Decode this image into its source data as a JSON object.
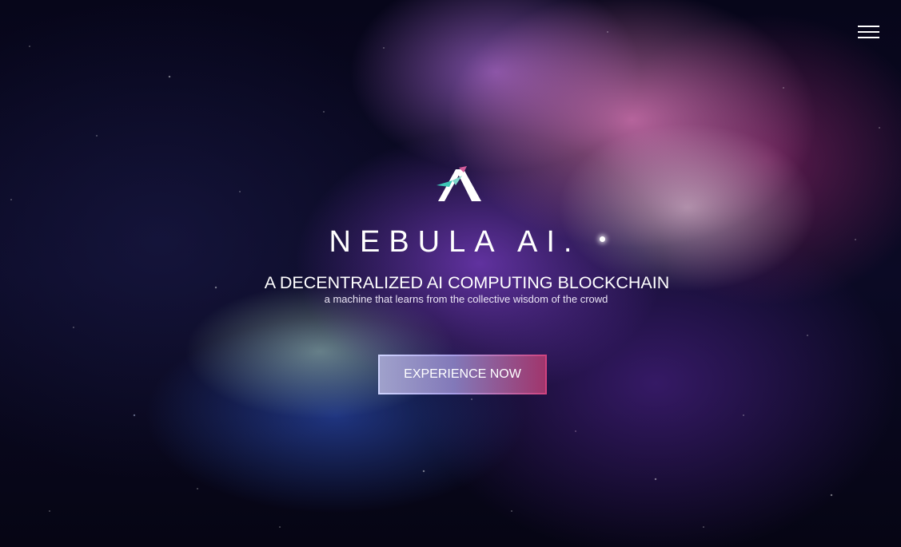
{
  "header": {
    "menu_icon": "hamburger-menu-icon"
  },
  "hero": {
    "logo_icon": "nebula-ai-logo-icon",
    "brand_name": "NEBULA AI.",
    "headline": "A DECENTRALIZED AI COMPUTING BLOCKCHAIN",
    "tagline": "a machine that learns from the collective wisdom of the crowd",
    "cta_label": "EXPERIENCE NOW"
  },
  "colors": {
    "background": "#07061a",
    "text": "#ffffff",
    "logo_teal": "#3ec7b6",
    "logo_pink": "#d35c9a",
    "cta_border_start": "#cfd4ff",
    "cta_border_end": "#d0427e"
  }
}
